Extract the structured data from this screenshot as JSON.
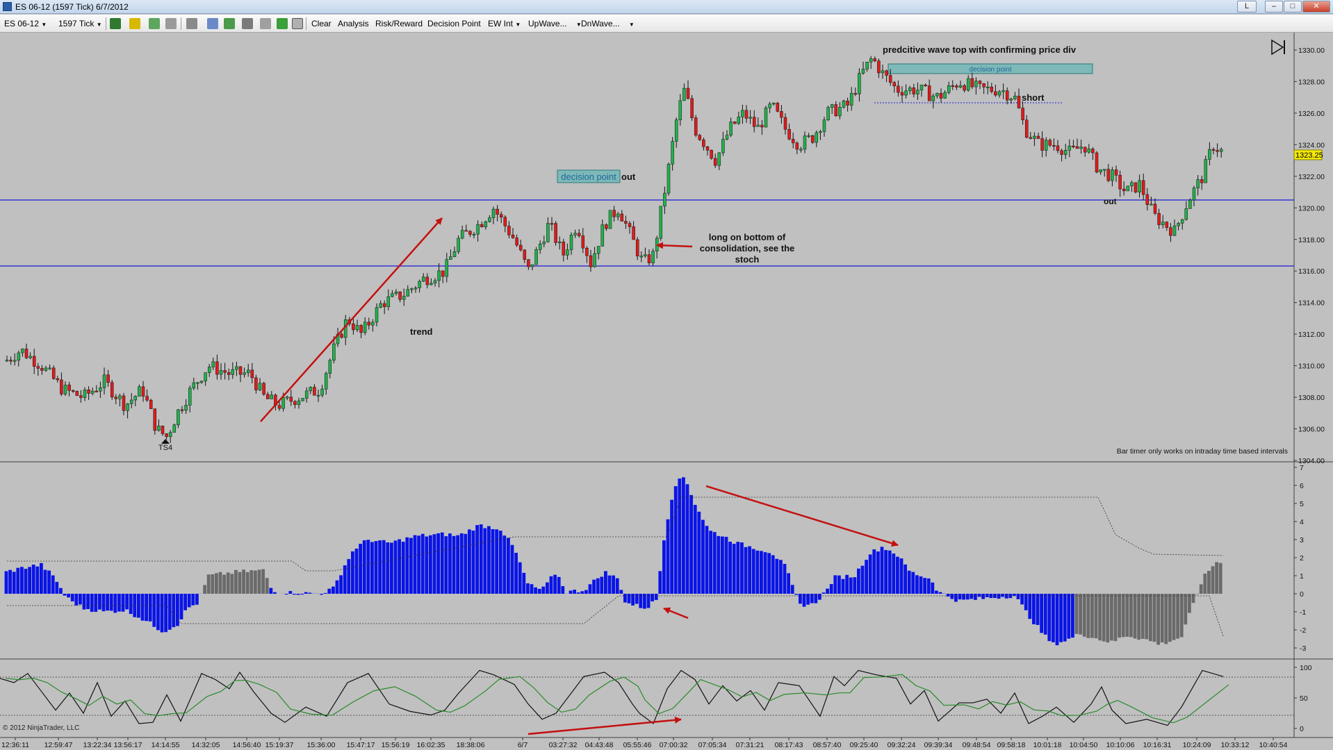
{
  "window": {
    "title": "ES 06-12 (1597 Tick)  6/7/2012",
    "buttons": [
      "L",
      "–",
      "□",
      "✕"
    ]
  },
  "toolbar": {
    "instrument": "ES 06-12",
    "interval": "1597 Tick",
    "items": [
      "Clear",
      "Analysis",
      "Risk/Reward",
      "Decision Point",
      "EW Int",
      "UpWave...",
      "DnWave..."
    ],
    "icons": [
      "bar-type-icon",
      "draw-pencil-icon",
      "crosshair-icon",
      "zoom-icon",
      "zoom-out-icon",
      "properties-icon",
      "strategies-icon",
      "indicators-icon",
      "data-box-icon",
      "dollar-icon",
      "window-icon"
    ]
  },
  "price_panel": {
    "price_labels": [
      "1330.00",
      "1328.00",
      "1326.00",
      "1324.00",
      "1322.00",
      "1320.00",
      "1318.00",
      "1316.00",
      "1314.00",
      "1312.00",
      "1310.00",
      "1308.00",
      "1306.00",
      "1304.00"
    ],
    "current_price": "1323.25",
    "bar_timer_note": "Bar timer only works on intraday time based intervals",
    "annotations": {
      "wave_top": "predcitive wave top with confirming price div",
      "decision_point_top": "decision point",
      "short": "short",
      "out_right": "out",
      "decision_point_mid": "decision point",
      "out_mid": "out",
      "long_note": [
        "long on bottom of",
        "consolidation, see the",
        "stoch"
      ],
      "trend": "trend",
      "ts4": "TS4"
    }
  },
  "histogram_panel": {
    "scale_labels": [
      "7",
      "6",
      "5",
      "4",
      "3",
      "2",
      "1",
      "0",
      "-1",
      "-2",
      "-3"
    ]
  },
  "stoch_panel": {
    "scale_labels": [
      "100",
      "50",
      "0"
    ],
    "copyright": "© 2012 NinjaTrader, LLC"
  },
  "time_axis": {
    "labels": [
      "12:36:11",
      "12:59:47",
      "13:22:34",
      "13:56:17",
      "14:14:55",
      "14:32:05",
      "14:56:40",
      "15:19:37",
      "15:36:00",
      "15:47:17",
      "15:56:19",
      "16:02:35",
      "18:38:06",
      "6/7",
      "03:27:32",
      "04:43:48",
      "05:55:46",
      "07:00:32",
      "07:05:34",
      "07:31:21",
      "08:17:43",
      "08:57:40",
      "09:25:40",
      "09:32:24",
      "09:39:34",
      "09:48:54",
      "09:58:18",
      "10:01:18",
      "10:04:50",
      "10:10:06",
      "10:16:31",
      "10:24:09",
      "10:33:12",
      "10:40:54"
    ]
  },
  "colors": {
    "background": "#c0c0c0",
    "up_candle": "#22b14c",
    "down_candle": "#e01b1b",
    "hist_blue": "#0a14e6",
    "hist_gray": "#6a6a6a",
    "arrow": "#c41010",
    "level_line": "#1a1ad8",
    "price_badge": "#f5e80a"
  }
}
